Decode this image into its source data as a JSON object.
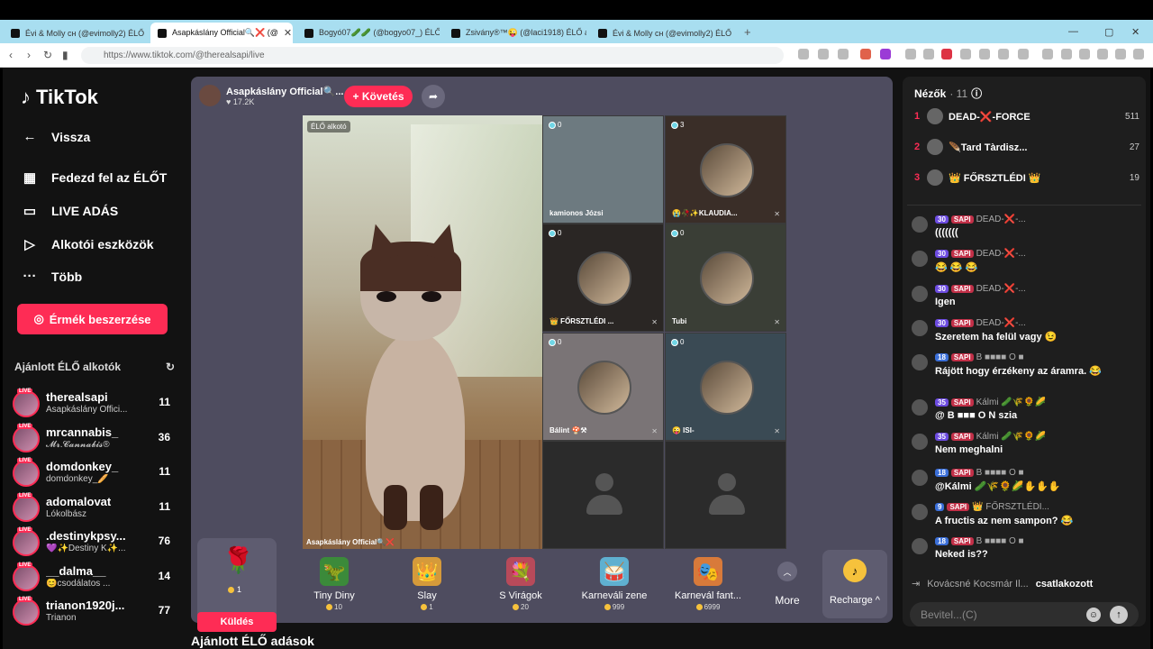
{
  "browser": {
    "tabs": [
      {
        "label": "Évi & Molly cн (@evimolly2) ÉLŐ adás"
      },
      {
        "label": "Asapkáslány Official🔍❌ (@"
      },
      {
        "label": "Bogyó07🥒🥒 (@bogyo07_) ÉLŐ a"
      },
      {
        "label": "Zsivány®™😜 (@laci1918) ÉLŐ adás"
      },
      {
        "label": "Évi & Molly cн (@evimolly2) ÉLŐ adás"
      }
    ],
    "new_tab": "+",
    "url": "https://www.tiktok.com/@therealsapi/live"
  },
  "sidebar": {
    "logo": "TikTok",
    "nav": [
      {
        "label": "Vissza",
        "icon": "back-icon",
        "glyph": "←"
      },
      {
        "label": "Fedezd fel az ÉLŐT",
        "icon": "live-tv-icon",
        "glyph": "▦"
      },
      {
        "label": "LIVE ADÁS",
        "icon": "camera-icon",
        "glyph": "▭"
      },
      {
        "label": "Alkotói eszközök",
        "icon": "creator-tools-icon",
        "glyph": "▷"
      },
      {
        "label": "Több",
        "icon": "more-dots-icon",
        "glyph": "···"
      }
    ],
    "coins_button": "Érmék beszerzése",
    "recommended_title": "Ajánlott ÉLŐ alkotók",
    "live_badge": "LIVE",
    "creators": [
      {
        "name": "therealsapi",
        "sub": "Asapkáslány Offici...",
        "count": "11"
      },
      {
        "name": "mrcannabis_",
        "sub": "𝓜𝓻.𝓒𝓪𝓷𝓷𝓪𝓫𝓲𝓼®",
        "count": "36"
      },
      {
        "name": "domdonkey_",
        "sub": "domdonkey_🥖",
        "count": "11"
      },
      {
        "name": "adomalovat",
        "sub": "Lókolbász",
        "count": "11"
      },
      {
        "name": ".destinykpsy...",
        "sub": "💜✨Destiny K✨...",
        "count": "76"
      },
      {
        "name": "__dalma__",
        "sub": "😊csodálatos ...",
        "count": "14"
      },
      {
        "name": "trianon1920j...",
        "sub": "Trianon",
        "count": "77"
      }
    ]
  },
  "stage": {
    "host_name": "Asapkáslány Official🔍...",
    "host_likes": "♥ 17.2K",
    "follow_button": "+ Követés",
    "main_label": "ÉLŐ alkotó",
    "main_name": "Asapkáslány Official🔍❌",
    "cells": [
      {
        "count": "0",
        "name": "kamionos Józsi",
        "bg": "#6d7a80"
      },
      {
        "count": "3",
        "name": "😭🥀✨KLAUDIA...",
        "bg": "#3a2e28"
      },
      {
        "count": "0",
        "name": "👑 FŐRSZTLÉDI ...",
        "bg": "#2a2624"
      },
      {
        "count": "0",
        "name": "Tubi",
        "bg": "#3a3e36"
      },
      {
        "count": "0",
        "name": "Bálint 🍄⚒",
        "bg": "#7a7476"
      },
      {
        "count": "0",
        "name": "😜 ISI-",
        "bg": "#3a4a54"
      }
    ],
    "gifts": [
      {
        "name": "Tiny Diny",
        "price": "10",
        "icon": "dino-icon",
        "glyph": "🦖"
      },
      {
        "name": "Slay",
        "price": "1",
        "icon": "slay-icon",
        "glyph": "👑"
      },
      {
        "name": "S Virágok",
        "price": "20",
        "icon": "flowers-icon",
        "glyph": "💐"
      },
      {
        "name": "Karneváli zene",
        "price": "999",
        "icon": "drum-icon",
        "glyph": "🥁"
      },
      {
        "name": "Karnevál fant...",
        "price": "6999",
        "icon": "carnival-icon",
        "glyph": "🎭"
      }
    ],
    "rose_price": "1",
    "send_button": "Küldés",
    "more_label": "More",
    "recharge_label": "Recharge ^"
  },
  "recommended_live_title": "Ajánlott ÉLŐ adások",
  "chat": {
    "viewers_title": "Nézők",
    "viewers_count": "· 11",
    "top_viewers": [
      {
        "rank": "1",
        "name": "DEAD-❌-FORCE",
        "score": "511"
      },
      {
        "rank": "2",
        "name": "🪶Tard Tàrdisz...",
        "score": "27"
      },
      {
        "rank": "3",
        "name": "👑 FŐRSZTLÉDI 👑",
        "score": "19"
      }
    ],
    "messages": [
      {
        "level": "30",
        "tag": "SAPI",
        "user": "DEAD-❌-...",
        "text": "(((((((",
        "blue": false
      },
      {
        "level": "30",
        "tag": "SAPI",
        "user": "DEAD-❌-...",
        "text": "😂 😂 😂",
        "blue": false
      },
      {
        "level": "30",
        "tag": "SAPI",
        "user": "DEAD-❌-...",
        "text": "Igen",
        "blue": false
      },
      {
        "level": "30",
        "tag": "SAPI",
        "user": "DEAD-❌-...",
        "text": "Szeretem ha felül vagy 😉",
        "blue": false
      },
      {
        "level": "18",
        "tag": "SAPI",
        "user": "B ■■■■ O ■",
        "text": "Rájött hogy érzékeny az áramra. 😂",
        "blue": true
      },
      {
        "level": "35",
        "tag": "SAPI",
        "user": "Kálmi 🥒🌾🌻🌽",
        "text": "@ B ■■■ O N szia",
        "blue": false
      },
      {
        "level": "35",
        "tag": "SAPI",
        "user": "Kálmi 🥒🌾🌻🌽",
        "text": "Nem meghalni",
        "blue": false
      },
      {
        "level": "18",
        "tag": "SAPI",
        "user": "B ■■■■ O ■",
        "text": "@Kálmi 🥒🌾🌻🌽✋✋✋",
        "blue": true
      },
      {
        "level": "9",
        "tag": "SAPI",
        "user": "👑 FŐRSZTLÉDI...",
        "text": "A fructis az nem sampon? 😂",
        "blue": true
      },
      {
        "level": "18",
        "tag": "SAPI",
        "user": "B ■■■■ O ■",
        "text": "Neked is??",
        "blue": true
      }
    ],
    "join_name": "Kovácsné Kocsmár Il...",
    "join_text": "csatlakozott",
    "input_placeholder": "Bevitel...(C)"
  },
  "colors": {
    "accent": "#fe2c55",
    "tab_bar": "#a8def0",
    "page_bg": "#121212",
    "stage_bg": "#4e4c5f"
  }
}
